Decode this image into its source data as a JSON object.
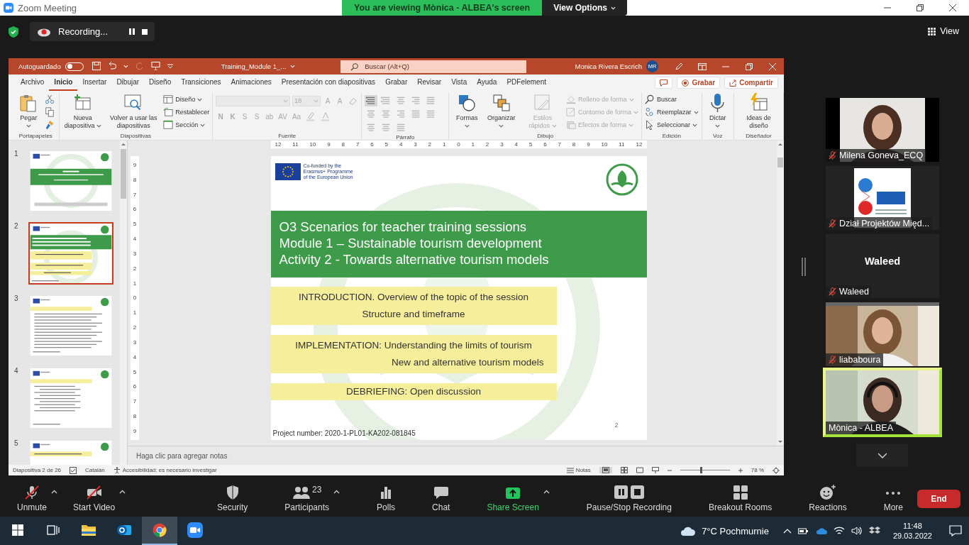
{
  "window": {
    "title": "Zoom Meeting"
  },
  "share_banner": {
    "message": "You are viewing Mònica - ALBEA's screen",
    "options": "View Options"
  },
  "meeting_bar": {
    "recording": "Recording...",
    "view": "View"
  },
  "powerpoint": {
    "autosave": {
      "label": "Autoguardado",
      "on": false
    },
    "document_title": "Training_Module 1_...",
    "search": {
      "placeholder": "Buscar (Alt+Q)"
    },
    "user": {
      "name": "Monica Rivera Escrich",
      "initials": "MR"
    },
    "tabs": [
      {
        "label": "Archivo",
        "selected": false
      },
      {
        "label": "Inicio",
        "selected": true
      },
      {
        "label": "Insertar",
        "selected": false
      },
      {
        "label": "Dibujar",
        "selected": false
      },
      {
        "label": "Diseño",
        "selected": false
      },
      {
        "label": "Transiciones",
        "selected": false
      },
      {
        "label": "Animaciones",
        "selected": false
      },
      {
        "label": "Presentación con diapositivas",
        "selected": false
      },
      {
        "label": "Grabar",
        "selected": false
      },
      {
        "label": "Revisar",
        "selected": false
      },
      {
        "label": "Vista",
        "selected": false
      },
      {
        "label": "Ayuda",
        "selected": false
      },
      {
        "label": "PDFelement",
        "selected": false
      }
    ],
    "actions": [
      {
        "kind": "comments"
      },
      {
        "kind": "record",
        "label": "Grabar"
      },
      {
        "kind": "share",
        "label": "Compartir"
      }
    ],
    "ribbon": [
      {
        "label": "Portapapeles",
        "items": [
          {
            "kind": "large",
            "label": "Pegar",
            "menu": true,
            "disabled": false
          },
          {
            "kind": "icon",
            "disabled": false
          },
          {
            "kind": "icon",
            "disabled": false
          },
          {
            "kind": "icon",
            "disabled": false
          }
        ]
      },
      {
        "label": "Diapositivas",
        "items": [
          {
            "kind": "large",
            "label": "Nueva diapositiva",
            "menu": true,
            "disabled": false
          },
          {
            "kind": "large",
            "label": "Volver a usar las diapositivas",
            "menu": false,
            "disabled": false
          },
          {
            "kind": "small",
            "label": "Diseño",
            "menu": true,
            "disabled": false
          },
          {
            "kind": "small",
            "label": "Restablecer",
            "menu": false,
            "disabled": false
          },
          {
            "kind": "small",
            "label": "Sección",
            "menu": true,
            "disabled": false
          }
        ]
      },
      {
        "label": "Fuente",
        "items": [
          {
            "kind": "box",
            "value": "",
            "disabled": true
          },
          {
            "kind": "box",
            "value": "18",
            "disabled": true
          },
          {
            "kind": "key",
            "label": "A",
            "disabled": true
          },
          {
            "kind": "key",
            "label": "A",
            "disabled": true
          },
          {
            "kind": "icon",
            "disabled": true
          },
          {
            "kind": "key",
            "label": "N",
            "disabled": true
          },
          {
            "kind": "key",
            "label": "K",
            "disabled": true
          },
          {
            "kind": "key",
            "label": "S",
            "disabled": true
          },
          {
            "kind": "key",
            "label": "S",
            "disabled": true
          },
          {
            "kind": "key",
            "label": "ab",
            "disabled": true
          },
          {
            "kind": "key",
            "label": "AV",
            "disabled": true
          },
          {
            "kind": "key",
            "label": "Aa",
            "disabled": true
          },
          {
            "kind": "icon",
            "disabled": true
          },
          {
            "kind": "icon",
            "disabled": true
          }
        ]
      },
      {
        "label": "Párrafo",
        "items": [
          {
            "kind": "icon",
            "disabled": false
          },
          {
            "kind": "icon",
            "disabled": true
          },
          {
            "kind": "icon",
            "disabled": true
          },
          {
            "kind": "icon",
            "disabled": true
          },
          {
            "kind": "icon",
            "disabled": true
          },
          {
            "kind": "icon",
            "disabled": true
          },
          {
            "kind": "icon",
            "disabled": true
          },
          {
            "kind": "icon",
            "disabled": true
          },
          {
            "kind": "icon",
            "disabled": true
          },
          {
            "kind": "icon",
            "disabled": true
          },
          {
            "kind": "icon",
            "disabled": true
          },
          {
            "kind": "icon",
            "disabled": true
          },
          {
            "kind": "icon",
            "disabled": true
          }
        ]
      },
      {
        "label": "Dibujo",
        "items": [
          {
            "kind": "large",
            "label": "Formas",
            "menu": true,
            "disabled": false
          },
          {
            "kind": "large",
            "label": "Organizar",
            "menu": true,
            "disabled": false
          },
          {
            "kind": "large",
            "label": "Estilos rápidos",
            "menu": true,
            "disabled": true
          },
          {
            "kind": "small",
            "label": "Relleno de forma",
            "menu": true,
            "disabled": true
          },
          {
            "kind": "small",
            "label": "Contorno de forma",
            "menu": true,
            "disabled": true
          },
          {
            "kind": "small",
            "label": "Efectos de forma",
            "menu": true,
            "disabled": true
          }
        ]
      },
      {
        "label": "Edición",
        "items": [
          {
            "kind": "small",
            "label": "Buscar",
            "menu": false,
            "disabled": false
          },
          {
            "kind": "small",
            "label": "Reemplazar",
            "menu": true,
            "disabled": false
          },
          {
            "kind": "small",
            "label": "Seleccionar",
            "menu": true,
            "disabled": false
          }
        ]
      },
      {
        "label": "Voz",
        "items": [
          {
            "kind": "large",
            "label": "Dictar",
            "menu": true,
            "disabled": false
          }
        ]
      },
      {
        "label": "Diseñador",
        "items": [
          {
            "kind": "large",
            "label": "Ideas de diseño",
            "menu": false,
            "disabled": false
          }
        ]
      }
    ],
    "thumbnails": [
      {
        "number": "1",
        "selected": false
      },
      {
        "number": "2",
        "selected": true
      },
      {
        "number": "3",
        "selected": false
      },
      {
        "number": "4",
        "selected": false
      },
      {
        "number": "5",
        "selected": false
      }
    ],
    "ruler": {
      "horizontal": [
        "12",
        "11",
        "10",
        "9",
        "8",
        "7",
        "6",
        "5",
        "4",
        "3",
        "2",
        "1",
        "0",
        "1",
        "2",
        "3",
        "4",
        "5",
        "6",
        "7",
        "8",
        "9",
        "10",
        "11",
        "12"
      ],
      "vertical": [
        "9",
        "8",
        "7",
        "6",
        "5",
        "4",
        "3",
        "2",
        "1",
        "0",
        "1",
        "2",
        "3",
        "4",
        "5",
        "6",
        "7",
        "8",
        "9"
      ]
    },
    "slide": {
      "funding": [
        "Co-funded by the",
        "Erasmus+ Programme",
        "of the European Union"
      ],
      "title_lines": [
        "O3 Scenarios for teacher training sessions",
        "Module 1 – Sustainable tourism development",
        "Activity 2 - Towards alternative tourism models"
      ],
      "sections": [
        {
          "lines": [
            "INTRODUCTION. Overview of the topic of the session",
            "Structure and timeframe"
          ]
        },
        {
          "lines": [
            "IMPLEMENTATION: Understanding the limits of tourism",
            "New and alternative tourism models"
          ]
        },
        {
          "lines": [
            "DEBRIEFING: Open discussion"
          ]
        }
      ],
      "project": "Project number: 2020-1-PL01-KA202-081845",
      "page": "2"
    },
    "notes": {
      "placeholder": "Haga clic para agregar notas"
    },
    "status_bar": {
      "slide": "Diapositiva 2 de 26",
      "language": "Catalán",
      "accessibility": "Accesibilidad: es necesario investigar",
      "notes": "Notas",
      "zoom": {
        "level": 0.4,
        "reading": "78 %"
      }
    }
  },
  "participants": [
    {
      "name": "Milena Goneva_ECQ",
      "kind": "video",
      "muted": true,
      "active": false
    },
    {
      "name": "Dział Projektów Międ...",
      "kind": "video",
      "muted": true,
      "active": false
    },
    {
      "name": "Waleed",
      "kind": "name_only",
      "display_name": "Waleed",
      "muted": true,
      "active": false
    },
    {
      "name": "liababoura",
      "kind": "video",
      "muted": true,
      "active": false
    },
    {
      "name": "Mònica - ALBEA",
      "kind": "video",
      "muted": false,
      "active": true
    }
  ],
  "toolbar": [
    {
      "kind": "mic",
      "label": "Unmute",
      "muted": true,
      "menu": true
    },
    {
      "kind": "video",
      "label": "Start Video",
      "muted": true,
      "menu": true
    },
    {
      "kind": "security",
      "label": "Security",
      "menu": false
    },
    {
      "kind": "participants",
      "label": "Participants",
      "count": "23",
      "menu": true
    },
    {
      "kind": "polls",
      "label": "Polls",
      "menu": false
    },
    {
      "kind": "chat",
      "label": "Chat",
      "menu": false
    },
    {
      "kind": "share",
      "label": "Share Screen",
      "menu": true
    },
    {
      "kind": "recording",
      "label": "Pause/Stop Recording",
      "menu": false
    },
    {
      "kind": "breakout",
      "label": "Breakout Rooms",
      "menu": false
    },
    {
      "kind": "reactions",
      "label": "Reactions",
      "menu": false
    },
    {
      "kind": "more",
      "label": "More",
      "menu": false
    }
  ],
  "end_button": "End",
  "taskbar": {
    "apps": [
      {
        "kind": "start",
        "selected": false
      },
      {
        "kind": "taskview",
        "selected": false
      },
      {
        "kind": "explorer",
        "selected": false
      },
      {
        "kind": "outlook",
        "selected": false
      },
      {
        "kind": "chrome",
        "selected": true
      },
      {
        "kind": "zoom",
        "selected": false
      }
    ],
    "weather": "7°C Pochmurnie",
    "time": "11:48",
    "date": "29.03.2022"
  }
}
